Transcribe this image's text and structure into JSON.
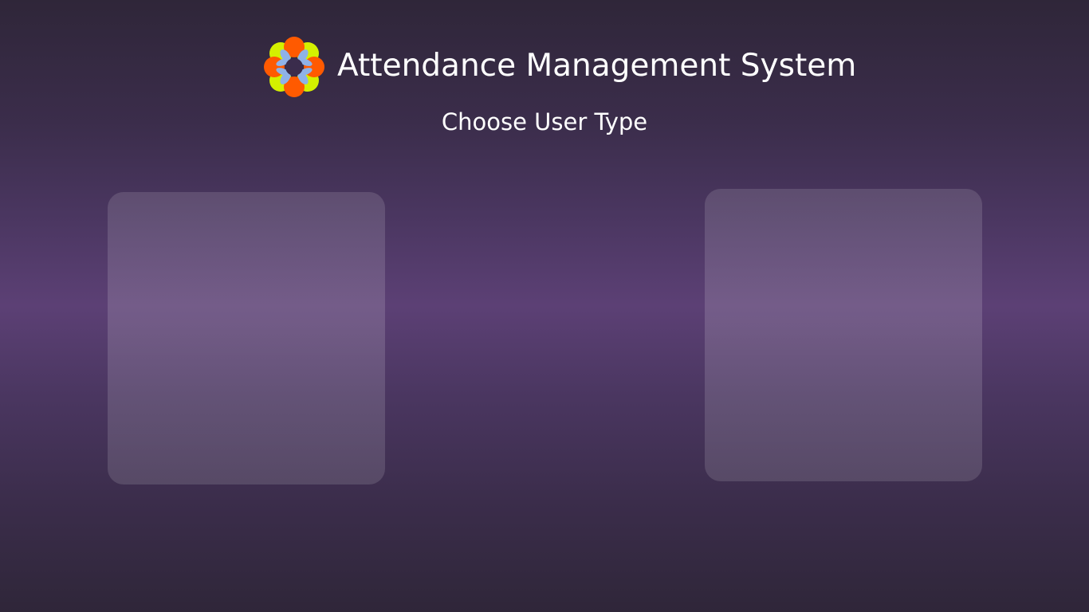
{
  "header": {
    "app_title": "Attendance Management System",
    "logo_icon": "flower-logo-icon",
    "subtitle": "Choose User Type"
  },
  "user_types": {
    "cards": [
      {
        "label": ""
      },
      {
        "label": ""
      }
    ]
  },
  "colors": {
    "background_top": "#2f2639",
    "background_mid": "#5c4075",
    "card_fill": "rgba(255,255,255,0.14)",
    "text": "#ffffff",
    "logo_orange": "#ff5a00",
    "logo_lime": "#d4f000",
    "logo_blue": "#8fb2e8"
  }
}
